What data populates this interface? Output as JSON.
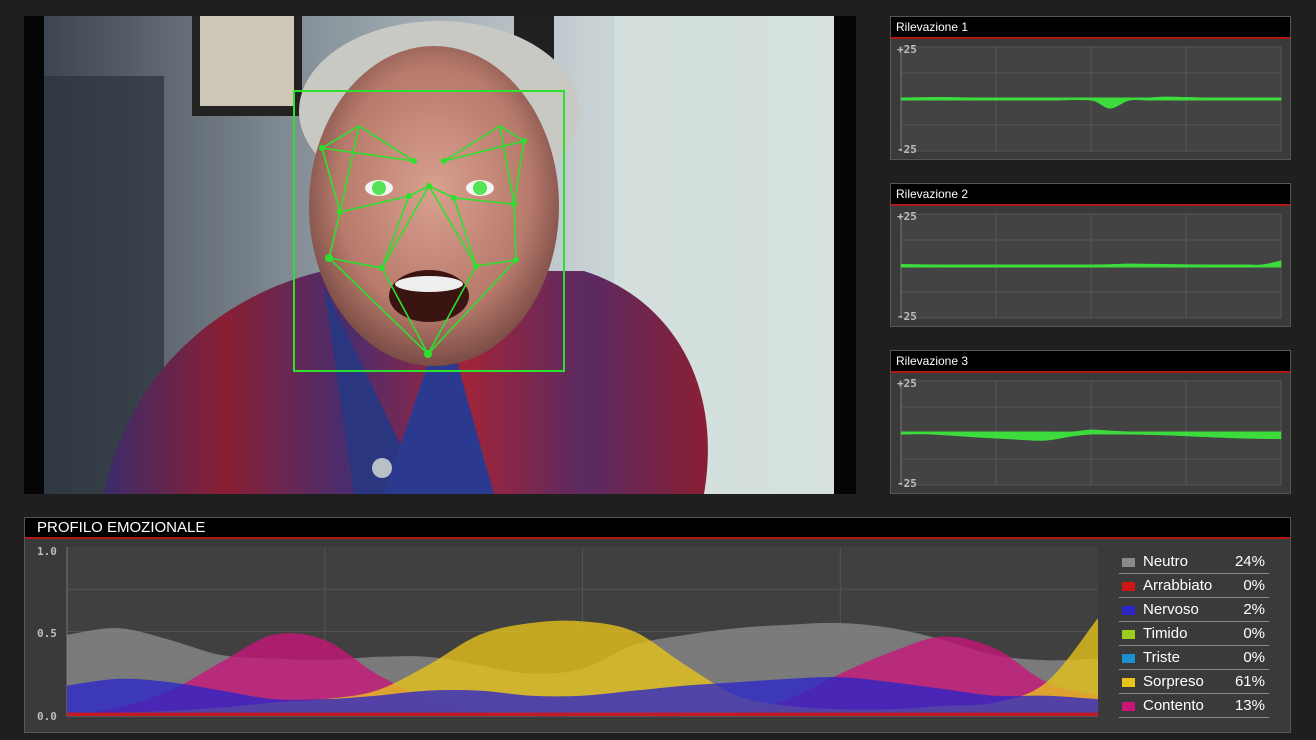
{
  "video": {
    "face_box_color": "#2ee02e",
    "background": "#0b0b0b"
  },
  "rilevazioni": [
    {
      "title": "Rilevazione 1",
      "y_max_label": "+25",
      "y_min_label": "-25",
      "chart_data": {
        "type": "area",
        "ylim": [
          -25,
          25
        ],
        "x": [
          0,
          10,
          20,
          30,
          40,
          50,
          55,
          60,
          65,
          70,
          80,
          90,
          100
        ],
        "values": [
          0.2,
          0.8,
          0.3,
          0.0,
          0.0,
          -0.6,
          -4.5,
          -0.5,
          0.3,
          1.0,
          0.5,
          0.2,
          -0.2
        ]
      }
    },
    {
      "title": "Rilevazione 2",
      "y_max_label": "+25",
      "y_min_label": "-25",
      "chart_data": {
        "type": "area",
        "ylim": [
          -25,
          25
        ],
        "x": [
          0,
          10,
          20,
          30,
          40,
          50,
          55,
          60,
          70,
          80,
          90,
          95,
          100
        ],
        "values": [
          0.8,
          0.5,
          0.2,
          0.1,
          0.2,
          0.4,
          0.7,
          1.0,
          0.8,
          0.4,
          0.2,
          0.5,
          2.5
        ]
      }
    },
    {
      "title": "Rilevazione 3",
      "y_max_label": "+25",
      "y_min_label": "-25",
      "chart_data": {
        "type": "area",
        "ylim": [
          -25,
          25
        ],
        "x": [
          0,
          8,
          20,
          30,
          38,
          45,
          50,
          55,
          60,
          70,
          80,
          90,
          100
        ],
        "values": [
          0.0,
          -0.5,
          -2.0,
          -3.0,
          -3.5,
          -1.5,
          1.5,
          1.0,
          0.2,
          -1.0,
          -1.8,
          -2.5,
          -2.8
        ]
      }
    }
  ],
  "profilo": {
    "title": "PROFILO EMOZIONALE",
    "y_labels": [
      "1.0",
      "0.5",
      "0.0"
    ],
    "legend": [
      {
        "name": "Neutro",
        "percent": "24%",
        "color": "#8a8a8a"
      },
      {
        "name": "Arrabbiato",
        "percent": "0%",
        "color": "#d01515"
      },
      {
        "name": "Nervoso",
        "percent": "2%",
        "color": "#2b25c8"
      },
      {
        "name": "Timido",
        "percent": "0%",
        "color": "#9ccc1c"
      },
      {
        "name": "Triste",
        "percent": "0%",
        "color": "#1e8fd0"
      },
      {
        "name": "Sorpreso",
        "percent": "61%",
        "color": "#e8c41a"
      },
      {
        "name": "Contento",
        "percent": "13%",
        "color": "#c8157a"
      }
    ],
    "chart_data": {
      "type": "area",
      "ylim": [
        0,
        1
      ],
      "x": [
        0,
        5,
        10,
        15,
        20,
        25,
        30,
        35,
        40,
        45,
        50,
        55,
        60,
        65,
        70,
        75,
        80,
        85,
        90,
        95,
        100
      ],
      "series": [
        {
          "name": "Neutro",
          "values": [
            0.48,
            0.52,
            0.45,
            0.36,
            0.34,
            0.33,
            0.35,
            0.35,
            0.3,
            0.25,
            0.28,
            0.42,
            0.48,
            0.52,
            0.54,
            0.55,
            0.52,
            0.45,
            0.36,
            0.33,
            0.34
          ]
        },
        {
          "name": "Contento",
          "values": [
            0.0,
            0.05,
            0.15,
            0.32,
            0.48,
            0.45,
            0.25,
            0.1,
            0.03,
            0.0,
            0.0,
            0.0,
            0.0,
            0.02,
            0.1,
            0.25,
            0.38,
            0.47,
            0.4,
            0.2,
            0.12
          ]
        },
        {
          "name": "Sorpreso",
          "values": [
            0.02,
            0.02,
            0.03,
            0.05,
            0.08,
            0.1,
            0.15,
            0.3,
            0.48,
            0.55,
            0.56,
            0.5,
            0.3,
            0.12,
            0.06,
            0.04,
            0.04,
            0.06,
            0.08,
            0.2,
            0.58
          ]
        },
        {
          "name": "Nervoso",
          "values": [
            0.18,
            0.22,
            0.2,
            0.15,
            0.1,
            0.1,
            0.12,
            0.15,
            0.15,
            0.12,
            0.12,
            0.15,
            0.18,
            0.2,
            0.22,
            0.23,
            0.2,
            0.16,
            0.12,
            0.12,
            0.1
          ]
        },
        {
          "name": "Arrabbiato",
          "values": [
            0.02,
            0.02,
            0.02,
            0.02,
            0.02,
            0.02,
            0.02,
            0.02,
            0.02,
            0.02,
            0.02,
            0.02,
            0.02,
            0.02,
            0.02,
            0.02,
            0.02,
            0.02,
            0.02,
            0.02,
            0.02
          ]
        }
      ]
    }
  }
}
